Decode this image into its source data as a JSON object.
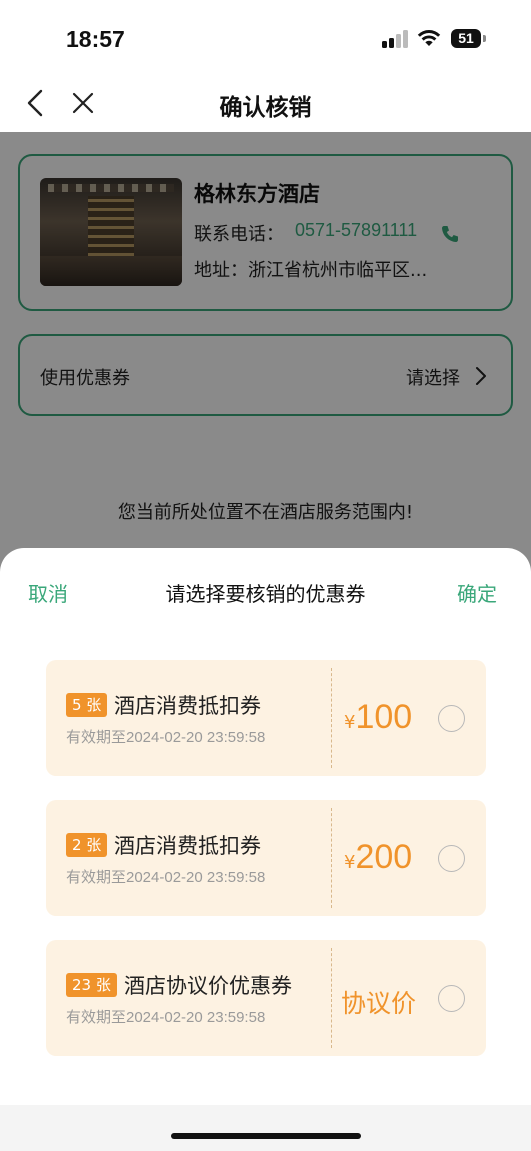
{
  "status_bar": {
    "time": "18:57",
    "battery": "51"
  },
  "nav": {
    "title": "确认核销"
  },
  "hotel": {
    "name": "格林东方酒店",
    "phone_label": "联系电话：",
    "phone": "0571-57891111",
    "address": "地址：浙江省杭州市临平区..."
  },
  "coupon_select": {
    "label": "使用优惠券",
    "value": "请选择"
  },
  "warning": "您当前所处位置不在酒店服务范围内!",
  "sheet": {
    "cancel": "取消",
    "title": "请选择要核销的优惠券",
    "confirm": "确定",
    "coupons": [
      {
        "count": "5 张",
        "name": "酒店消费抵扣券",
        "valid": "有效期至2024-02-20 23:59:58",
        "currency": "¥",
        "amount": "100"
      },
      {
        "count": "2 张",
        "name": "酒店消费抵扣券",
        "valid": "有效期至2024-02-20 23:59:58",
        "currency": "¥",
        "amount": "200"
      },
      {
        "count": "23 张",
        "name": "酒店协议价优惠券",
        "valid": "有效期至2024-02-20 23:59:58",
        "price_text": "协议价"
      }
    ]
  },
  "colors": {
    "accent": "#3aa77a",
    "coupon_orange": "#f0932b",
    "coupon_bg": "#fdf2e2"
  }
}
